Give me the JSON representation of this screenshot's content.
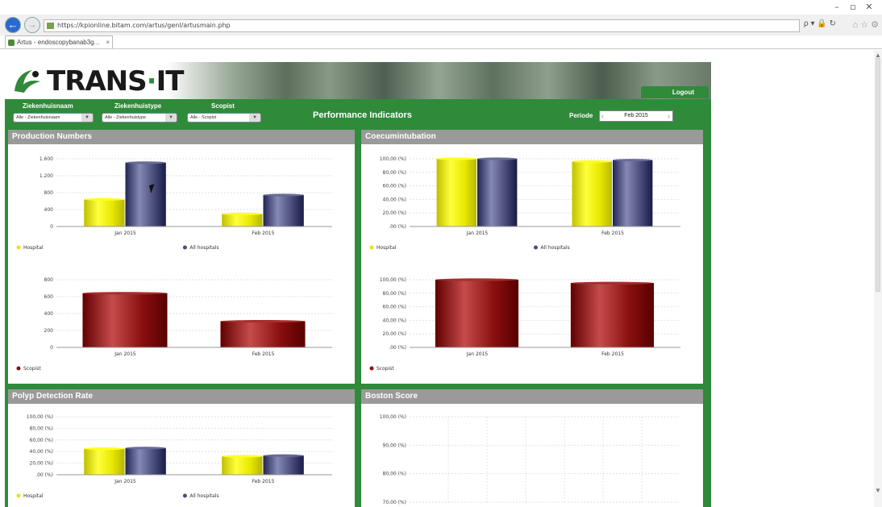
{
  "browser": {
    "url": "https://kpionline.bitam.com/artus/genl/artusmain.php",
    "tab_title": "Artus - endoscopybanab3g...",
    "tab_close": "×",
    "back_glyph": "←",
    "forward_glyph": "→",
    "addr_tools": "ρ ▾ 🔒 ↻",
    "right_tools": "⌂ ☆ ⚙",
    "titlebar_controls": [
      "–",
      "▫",
      "✕"
    ],
    "scroll_up": "▲",
    "scroll_down": "▼"
  },
  "brand": {
    "logo_main": "TRANS",
    "logo_sep": "·",
    "logo_end": "IT",
    "logout_label": "Logout",
    "brand_color": "#2f8a3a"
  },
  "filters": {
    "ziekenhuisnaam": {
      "label": "Ziekenhuisnaam",
      "value": "Alle - Ziekenhuisnaam"
    },
    "ziekenhuistype": {
      "label": "Ziekenhuistype",
      "value": "Alle - Ziekenhuistype"
    },
    "scopist": {
      "label": "Scopist",
      "value": "Alle - Scopist"
    }
  },
  "page_heading": "Performance Indicators",
  "periode": {
    "label": "Periode",
    "value": "Feb 2015",
    "prev_glyph": "‹",
    "next_glyph": "›"
  },
  "panels": {
    "production": {
      "title": "Production Numbers"
    },
    "coecum": {
      "title": "Coecumintubation"
    },
    "polyp": {
      "title": "Polyp Detection Rate"
    },
    "boston": {
      "title": "Boston Score"
    }
  },
  "chart_data": [
    {
      "id": "production-top",
      "type": "bar",
      "categories": [
        "Jan 2015",
        "Feb 2015"
      ],
      "series": [
        {
          "name": "Hospital",
          "color": "#e8e800",
          "values": [
            560,
            260
          ]
        },
        {
          "name": "All hospitals",
          "color": "#4a4d7a",
          "values": [
            1320,
            650
          ]
        }
      ],
      "ylim": [
        0,
        1400
      ],
      "yticks": [
        "0",
        "400",
        "800",
        "1.200",
        "1.600"
      ],
      "legend_position": "bottom"
    },
    {
      "id": "production-bottom",
      "type": "bar",
      "categories": [
        "Jan 2015",
        "Feb 2015"
      ],
      "series": [
        {
          "name": "Scopist",
          "color": "#8a0f0f",
          "values": [
            560,
            270
          ]
        }
      ],
      "ylim": [
        0,
        700
      ],
      "yticks": [
        "0",
        "200",
        "400",
        "600",
        "800"
      ],
      "legend_position": "bottom"
    },
    {
      "id": "coecum-top",
      "type": "bar",
      "categories": [
        "Jan 2015",
        "Feb 2015"
      ],
      "series": [
        {
          "name": "Hospital",
          "color": "#e8e800",
          "values": [
            100,
            96
          ]
        },
        {
          "name": "All hospitals",
          "color": "#4a4d7a",
          "values": [
            100,
            98
          ]
        }
      ],
      "ylim": [
        0,
        100
      ],
      "yticks": [
        ".00 (%)",
        "20,00 (%)",
        "40,00 (%)",
        "60,00 (%)",
        "80,00 (%)",
        "100,00 (%)"
      ],
      "legend_position": "bottom"
    },
    {
      "id": "coecum-bottom",
      "type": "bar",
      "categories": [
        "Jan 2015",
        "Feb 2015"
      ],
      "series": [
        {
          "name": "Scopist",
          "color": "#8a0f0f",
          "values": [
            100,
            95
          ]
        }
      ],
      "ylim": [
        0,
        100
      ],
      "yticks": [
        ".00 (%)",
        "20,00 (%)",
        "40,00 (%)",
        "60,00 (%)",
        "80,00 (%)",
        "100,00 (%)"
      ],
      "legend_position": "bottom"
    },
    {
      "id": "polyp-top",
      "type": "bar",
      "categories": [
        "Jan 2015",
        "Feb 2015"
      ],
      "series": [
        {
          "name": "Hospital",
          "color": "#e8e800",
          "values": [
            45,
            32
          ]
        },
        {
          "name": "All hospitals",
          "color": "#4a4d7a",
          "values": [
            46,
            33
          ]
        }
      ],
      "ylim": [
        0,
        100
      ],
      "yticks": [
        ".00 (%)",
        "20,00 (%)",
        "40,00 (%)",
        "60,00 (%)",
        "80,00 (%)",
        "100,00 (%)"
      ],
      "legend_position": "bottom"
    },
    {
      "id": "boston-top",
      "type": "bar",
      "categories": [],
      "series": [],
      "ylim": [
        70,
        100
      ],
      "yticks": [
        "70,00 (%)",
        "80,00 (%)",
        "90,00 (%)",
        "100,00 (%)"
      ],
      "legend_position": "bottom"
    }
  ]
}
